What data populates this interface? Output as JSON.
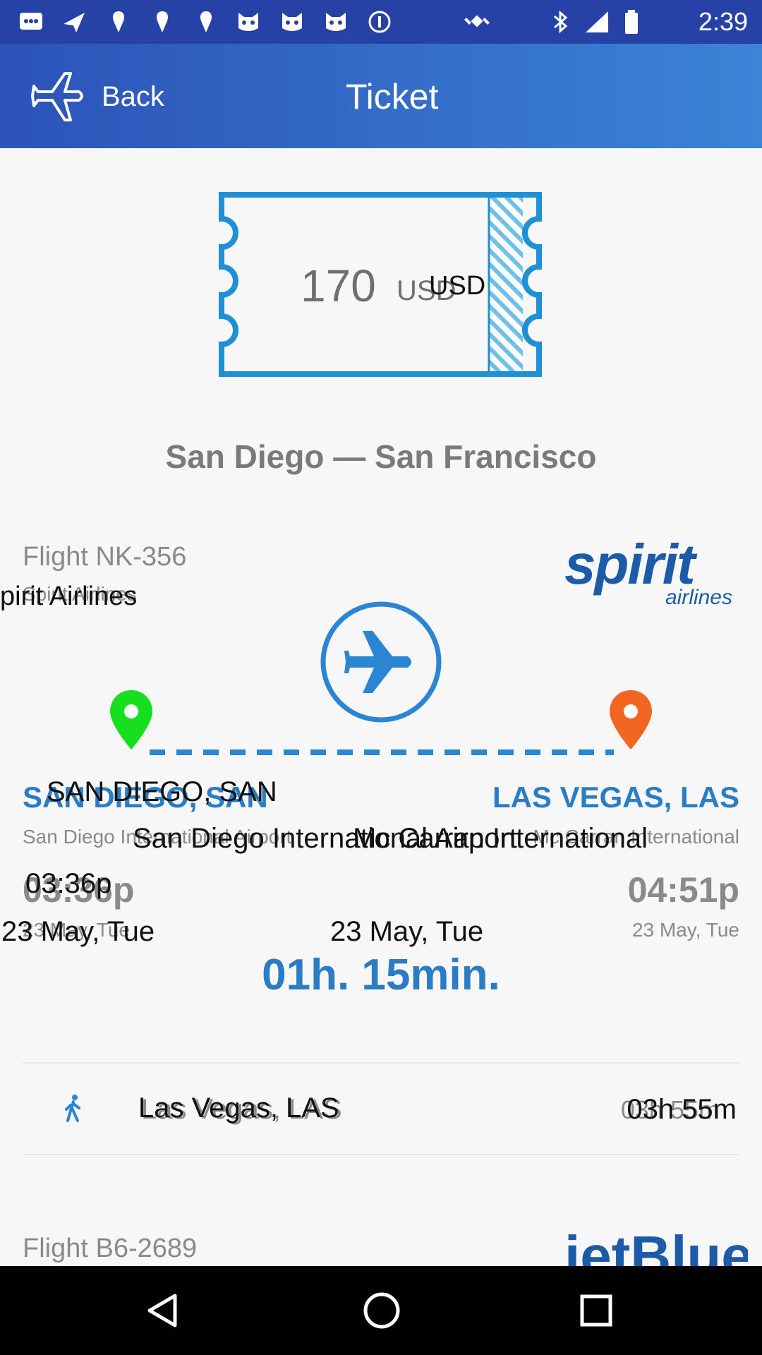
{
  "status_bar": {
    "time": "2:39",
    "icons": [
      "chat-icon",
      "plane-icon",
      "location-pin-icon",
      "location-pin-icon",
      "location-pin-icon",
      "cat-icon",
      "cat-icon",
      "cat-icon",
      "info-icon",
      "satellite-icon",
      "bluetooth-icon",
      "signal-icon",
      "battery-icon"
    ]
  },
  "app_bar": {
    "back_label": "Back",
    "title": "Ticket"
  },
  "ticket": {
    "price": "170",
    "currency": "USD",
    "currency_overlay": "USD"
  },
  "route_title": "San Diego — San Francisco",
  "flight1": {
    "number": "Flight NK-356",
    "airline": "Spirit Airlines",
    "airline_overlay": "pirit Airlines",
    "logo_word": "spirit",
    "logo_sub": "airlines",
    "origin": {
      "city": "SAN DIEGO, SAN",
      "city_overlay": "SAN DIEGO, SAN",
      "airport": "San Diego International Airport",
      "time": "03:36p",
      "time_overlay": "03:36p",
      "date": "23 May, Tue",
      "date_overlay": "23 May, Tue"
    },
    "destination": {
      "city": "LAS VEGAS, LAS",
      "airport": "Mc Carran International",
      "time": "04:51p",
      "date": "23 May, Tue"
    },
    "airport_overlay": "San Diego International Airport",
    "airport_overlay2": "Mc Carran International",
    "date_overlay_center": "23 May, Tue",
    "duration": "01h. 15min.",
    "colors": {
      "origin_pin": "#16e01d",
      "destination_pin": "#f26522",
      "route": "#2a85d3"
    }
  },
  "layover": {
    "city": "Las Vegas, LAS",
    "city_overlay": "Las Vegas, LAS",
    "time": "03h 55m",
    "time_overlay": "03h 55m"
  },
  "flight2": {
    "number": "Flight B6-2689",
    "logo_word": "jetBlue"
  }
}
